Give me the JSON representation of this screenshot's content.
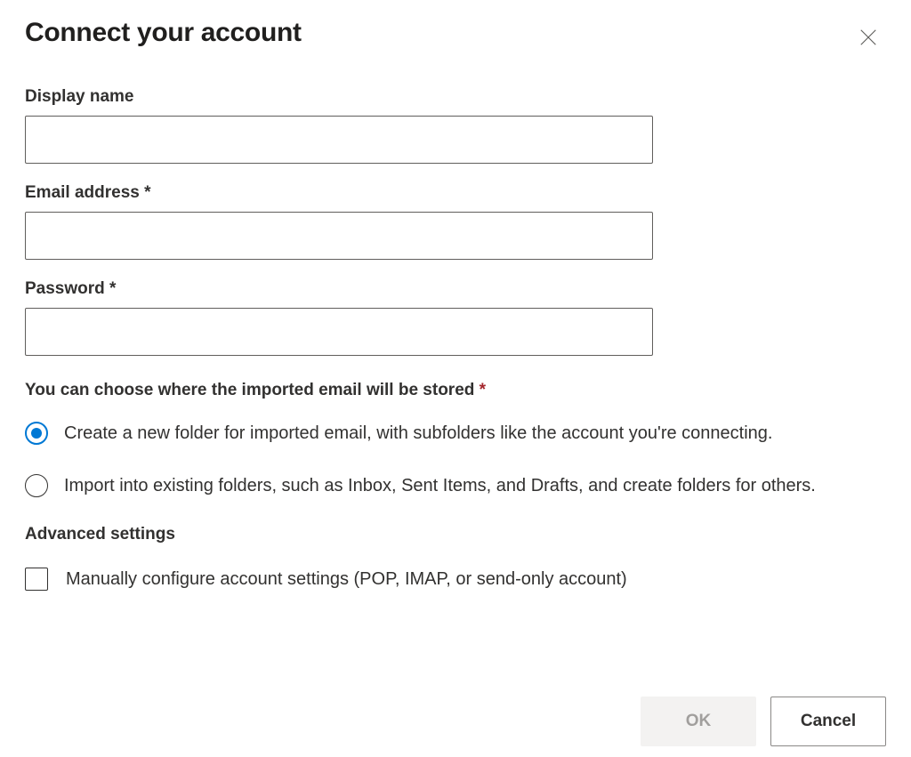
{
  "dialog": {
    "title": "Connect your account"
  },
  "fields": {
    "display_name": {
      "label": "Display name",
      "value": ""
    },
    "email": {
      "label": "Email address *",
      "value": ""
    },
    "password": {
      "label": "Password *",
      "value": ""
    }
  },
  "storage": {
    "section_label_pre": "You can choose where the imported email will be stored ",
    "section_label_req": "*",
    "option_new_folder": "Create a new folder for imported email, with subfolders like the account you're connecting.",
    "option_existing": "Import into existing folders, such as Inbox, Sent Items, and Drafts, and create folders for others.",
    "selected": "new_folder"
  },
  "advanced": {
    "title": "Advanced settings",
    "manual_label": "Manually configure account settings (POP, IMAP, or send-only account)",
    "manual_checked": false
  },
  "buttons": {
    "ok": "OK",
    "cancel": "Cancel"
  }
}
